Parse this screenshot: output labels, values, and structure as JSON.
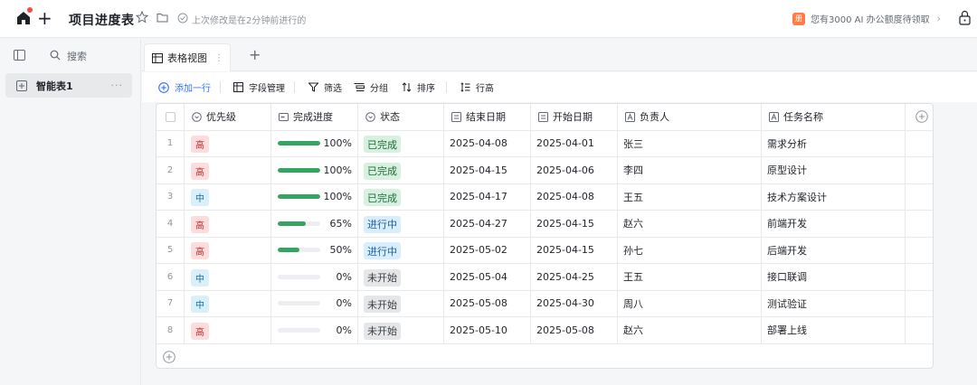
{
  "header": {
    "title": "项目进度表",
    "save_status": "上次修改是在2分钟前进行的",
    "quota_badge": "册",
    "quota_text": "您有3000 AI 办公额度待领取",
    "quota_chevron": "›"
  },
  "sidebar": {
    "search_label": "搜索",
    "table_name": "智能表1",
    "more": "···"
  },
  "tabs": {
    "active_label": "表格视图",
    "more": "⋮",
    "add": "+"
  },
  "toolbar": {
    "add_row": "添加一行",
    "fields": "字段管理",
    "filter": "筛选",
    "group": "分组",
    "sort": "排序",
    "row_height": "行高"
  },
  "columns": {
    "priority": "优先级",
    "progress": "完成进度",
    "status": "状态",
    "end_date": "结束日期",
    "start_date": "开始日期",
    "owner": "负责人",
    "task": "任务名称"
  },
  "rows": [
    {
      "no": "1",
      "priority": "高",
      "level": "high",
      "progress": 1.0,
      "progress_text": "100%",
      "status": "已完成",
      "state": "done",
      "end": "2025-04-08",
      "start": "2025-04-01",
      "owner": "张三",
      "task": "需求分析"
    },
    {
      "no": "2",
      "priority": "高",
      "level": "high",
      "progress": 1.0,
      "progress_text": "100%",
      "status": "已完成",
      "state": "done",
      "end": "2025-04-15",
      "start": "2025-04-06",
      "owner": "李四",
      "task": "原型设计"
    },
    {
      "no": "3",
      "priority": "中",
      "level": "mid",
      "progress": 1.0,
      "progress_text": "100%",
      "status": "已完成",
      "state": "done",
      "end": "2025-04-17",
      "start": "2025-04-08",
      "owner": "王五",
      "task": "技术方案设计"
    },
    {
      "no": "4",
      "priority": "高",
      "level": "high",
      "progress": 0.65,
      "progress_text": "65%",
      "status": "进行中",
      "state": "doing",
      "end": "2025-04-27",
      "start": "2025-04-15",
      "owner": "赵六",
      "task": "前端开发"
    },
    {
      "no": "5",
      "priority": "高",
      "level": "high",
      "progress": 0.5,
      "progress_text": "50%",
      "status": "进行中",
      "state": "doing",
      "end": "2025-05-02",
      "start": "2025-04-15",
      "owner": "孙七",
      "task": "后端开发"
    },
    {
      "no": "6",
      "priority": "中",
      "level": "mid",
      "progress": 0.0,
      "progress_text": "0%",
      "status": "未开始",
      "state": "todo",
      "end": "2025-05-04",
      "start": "2025-04-25",
      "owner": "王五",
      "task": "接口联调"
    },
    {
      "no": "7",
      "priority": "中",
      "level": "mid",
      "progress": 0.0,
      "progress_text": "0%",
      "status": "未开始",
      "state": "todo",
      "end": "2025-05-08",
      "start": "2025-04-30",
      "owner": "周八",
      "task": "测试验证"
    },
    {
      "no": "8",
      "priority": "高",
      "level": "high",
      "progress": 0.0,
      "progress_text": "0%",
      "status": "未开始",
      "state": "todo",
      "end": "2025-05-10",
      "start": "2025-05-08",
      "owner": "赵六",
      "task": "部署上线"
    }
  ],
  "colors": {
    "accent": "#3370ff",
    "progress_fill": "#34a461",
    "priority_high_bg": "#fcdcdc",
    "priority_mid_bg": "#d9f0fb",
    "status_done_bg": "#d7f0df",
    "status_doing_bg": "#d9eefc",
    "status_todo_bg": "#e5e6e8",
    "notify_dot": "#f54a45"
  },
  "icons": [
    "home-icon",
    "plus-icon",
    "star-icon",
    "folder-icon",
    "check-circle-icon",
    "gift-icon",
    "chevron-right-icon",
    "lock-icon",
    "sidebar-toggle-icon",
    "search-icon",
    "table-icon",
    "grid-view-icon",
    "add-circle-icon",
    "filter-icon",
    "group-icon",
    "sort-icon",
    "row-height-icon"
  ]
}
